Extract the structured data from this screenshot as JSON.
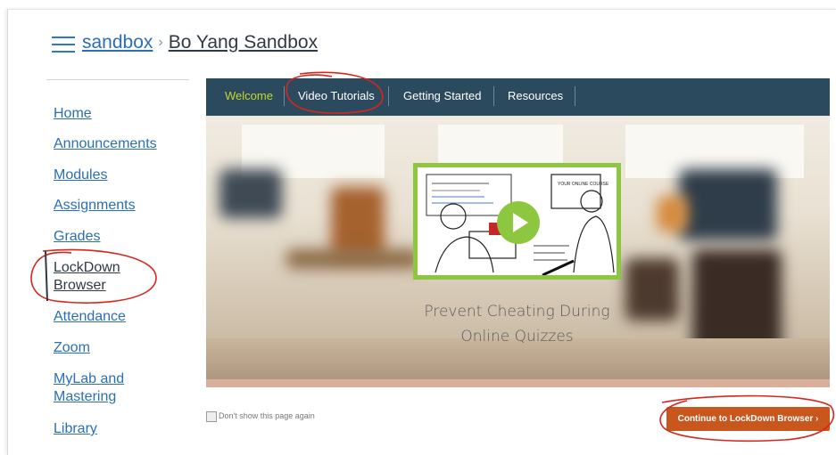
{
  "breadcrumb": {
    "course_code": "sandbox",
    "course_name": "Bo Yang Sandbox"
  },
  "sidebar": {
    "items": [
      {
        "label": "Home"
      },
      {
        "label": "Announcements"
      },
      {
        "label": "Modules"
      },
      {
        "label": "Assignments"
      },
      {
        "label": "Grades"
      },
      {
        "label": "LockDown Browser"
      },
      {
        "label": "Attendance"
      },
      {
        "label": "Zoom"
      },
      {
        "label": "MyLab and Mastering"
      },
      {
        "label": "Library"
      }
    ]
  },
  "tabs": [
    {
      "label": "Welcome",
      "active": true
    },
    {
      "label": "Video Tutorials",
      "active": false
    },
    {
      "label": "Getting Started",
      "active": false
    },
    {
      "label": "Resources",
      "active": false
    }
  ],
  "hero": {
    "tagline_line1": "Prevent Cheating During",
    "tagline_line2": "Online Quizzes",
    "video_screen_text": "YOUR ONLINE COURSE"
  },
  "footer": {
    "dont_show_label": "Don't show this page again",
    "continue_label": "Continue to LockDown Browser ›"
  },
  "colors": {
    "tabbar": "#2c4a5e",
    "active_tab": "#c1d72e",
    "accent_green": "#8dc63f",
    "cta": "#c8561d",
    "link": "#2a6fb6",
    "annotation_red": "#d9251c"
  },
  "icons": {
    "menu": "hamburger-icon",
    "play": "play-icon"
  }
}
